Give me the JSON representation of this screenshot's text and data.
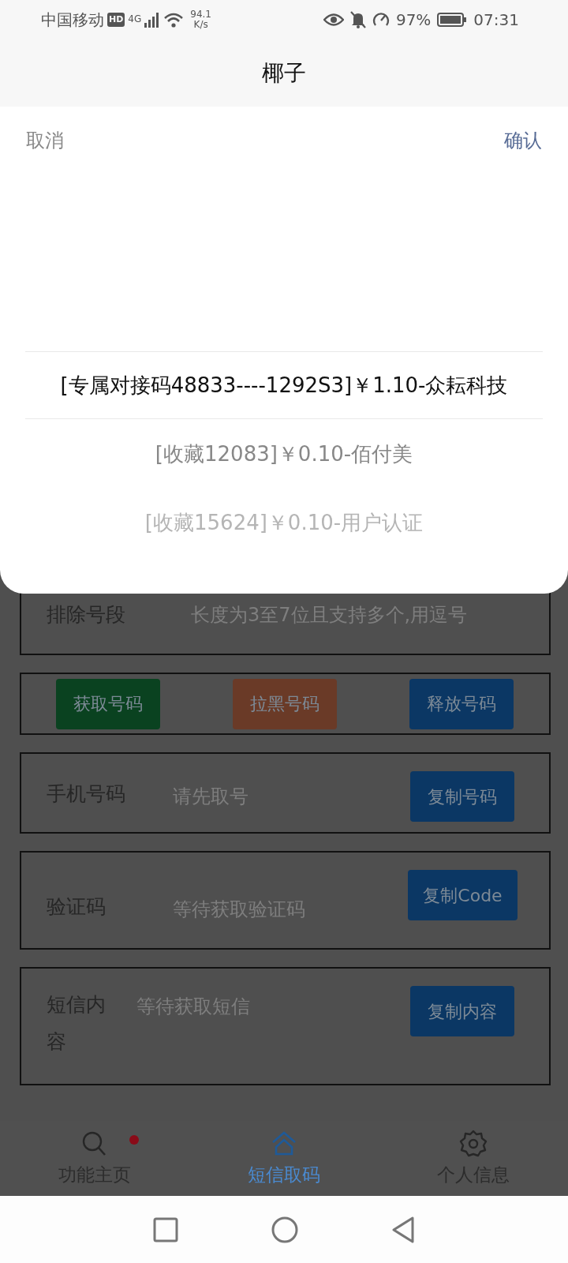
{
  "status_bar": {
    "carrier": "中国移动",
    "hd": "HD",
    "network": "4G",
    "speed": "94.1",
    "speed_unit": "K/s",
    "battery": "97%",
    "time": "07:31"
  },
  "title": "椰子",
  "picker": {
    "cancel": "取消",
    "confirm": "确认",
    "options": [
      {
        "label": "[专属对接码48833----1292S3]￥1.10-众耘科技",
        "selected": true
      },
      {
        "label": "[收藏12083]￥0.10-佰付美",
        "selected": false
      },
      {
        "label": "[收藏15624]￥0.10-用户认证",
        "selected": false
      }
    ]
  },
  "form": {
    "rows": [
      {
        "kind": "input",
        "label": "排除号段",
        "placeholder": "长度为3至7位且支持多个,用逗号"
      },
      {
        "kind": "actions",
        "buttons": [
          {
            "label": "获取号码",
            "color": "#0a4220"
          },
          {
            "label": "拉黑号码",
            "color": "#6a3a27"
          },
          {
            "label": "释放号码",
            "color": "#0b3764"
          }
        ]
      },
      {
        "kind": "output",
        "label": "手机号码",
        "placeholder": "请先取号",
        "button": "复制号码"
      },
      {
        "kind": "output",
        "label": "验证码",
        "placeholder": "等待获取验证码",
        "button": "复制Code"
      },
      {
        "kind": "message",
        "label": "短信内容",
        "placeholder": "等待获取短信",
        "button": "复制内容"
      }
    ]
  },
  "tabs": [
    {
      "label": "功能主页",
      "selected": false,
      "dot": true
    },
    {
      "label": "短信取码",
      "selected": true,
      "dot": false
    },
    {
      "label": "个人信息",
      "selected": false,
      "dot": false
    }
  ]
}
